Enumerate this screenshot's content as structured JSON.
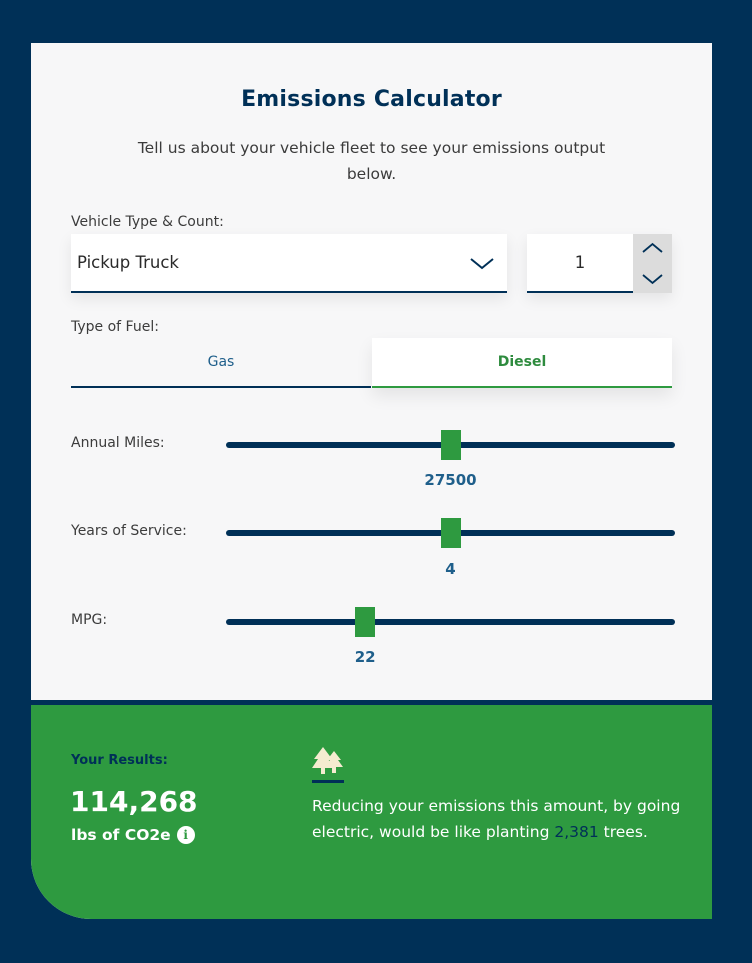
{
  "calculator": {
    "title": "Emissions Calculator",
    "subtitle": "Tell us about your vehicle fleet to see your emissions output below.",
    "vehicle": {
      "label": "Vehicle Type & Count:",
      "selected_type": "Pickup Truck",
      "count": "1"
    },
    "fuel": {
      "label": "Type of Fuel:",
      "options": [
        "Gas",
        "Diesel"
      ],
      "selected": "Diesel"
    },
    "sliders": {
      "annual_miles": {
        "label": "Annual Miles:",
        "value": "27500",
        "fraction": 0.5
      },
      "years_of_service": {
        "label": "Years of Service:",
        "value": "4",
        "fraction": 0.5
      },
      "mpg": {
        "label": "MPG:",
        "value": "22",
        "fraction": 0.31
      }
    }
  },
  "results": {
    "label": "Your Results:",
    "amount": "114,268",
    "unit": "lbs of CO2e",
    "text_before": "Reducing your emissions this amount, by going electric, would be like planting",
    "trees_count": "2,381",
    "text_after": "trees."
  },
  "colors": {
    "navy": "#003057",
    "green": "#2e9a40",
    "card": "#f7f7f8",
    "value_blue": "#1f5f8b"
  },
  "icons": [
    "chevron-down-icon",
    "chevron-up-icon",
    "info-icon",
    "trees-icon"
  ]
}
